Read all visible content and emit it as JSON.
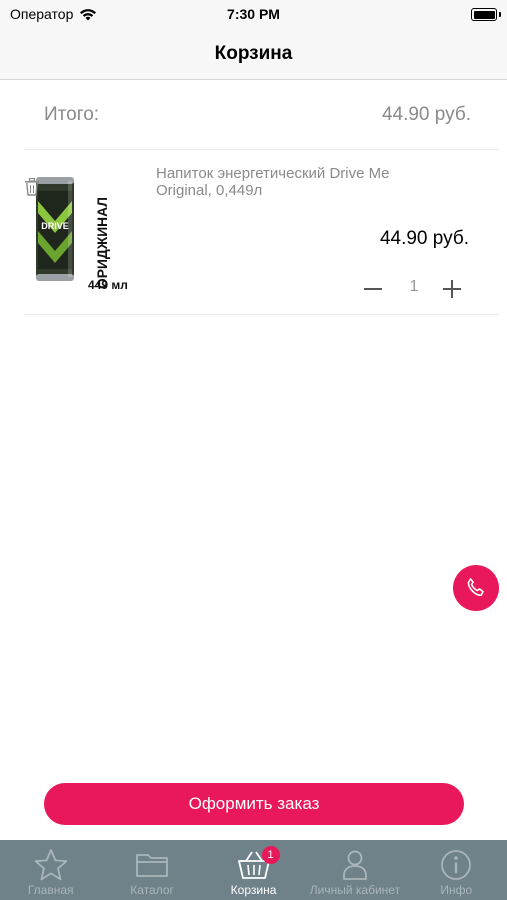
{
  "status_bar": {
    "carrier": "Оператор",
    "time": "7:30 PM"
  },
  "nav": {
    "title": "Корзина"
  },
  "total": {
    "label": "Итого:",
    "value": "44.90 руб."
  },
  "cart_items": [
    {
      "name": "Напиток энергетический Drive Me Original, 0,449л",
      "price": "44.90 руб.",
      "quantity": "1",
      "image": {
        "brand_text": "DRIVE",
        "side_text": "ОРИДЖИНАЛ",
        "volume_text": "449 мл"
      }
    }
  ],
  "checkout": {
    "label": "Оформить заказ"
  },
  "tabs": [
    {
      "label": "Главная",
      "icon": "star-icon"
    },
    {
      "label": "Каталог",
      "icon": "folder-icon"
    },
    {
      "label": "Корзина",
      "icon": "basket-icon",
      "badge": "1",
      "active": true
    },
    {
      "label": "Личный кабинет",
      "icon": "person-icon"
    },
    {
      "label": "Инфо",
      "icon": "info-icon"
    }
  ],
  "colors": {
    "accent": "#e8185a",
    "tab_bar": "#6f8189",
    "muted_text": "#8a8a8a"
  }
}
